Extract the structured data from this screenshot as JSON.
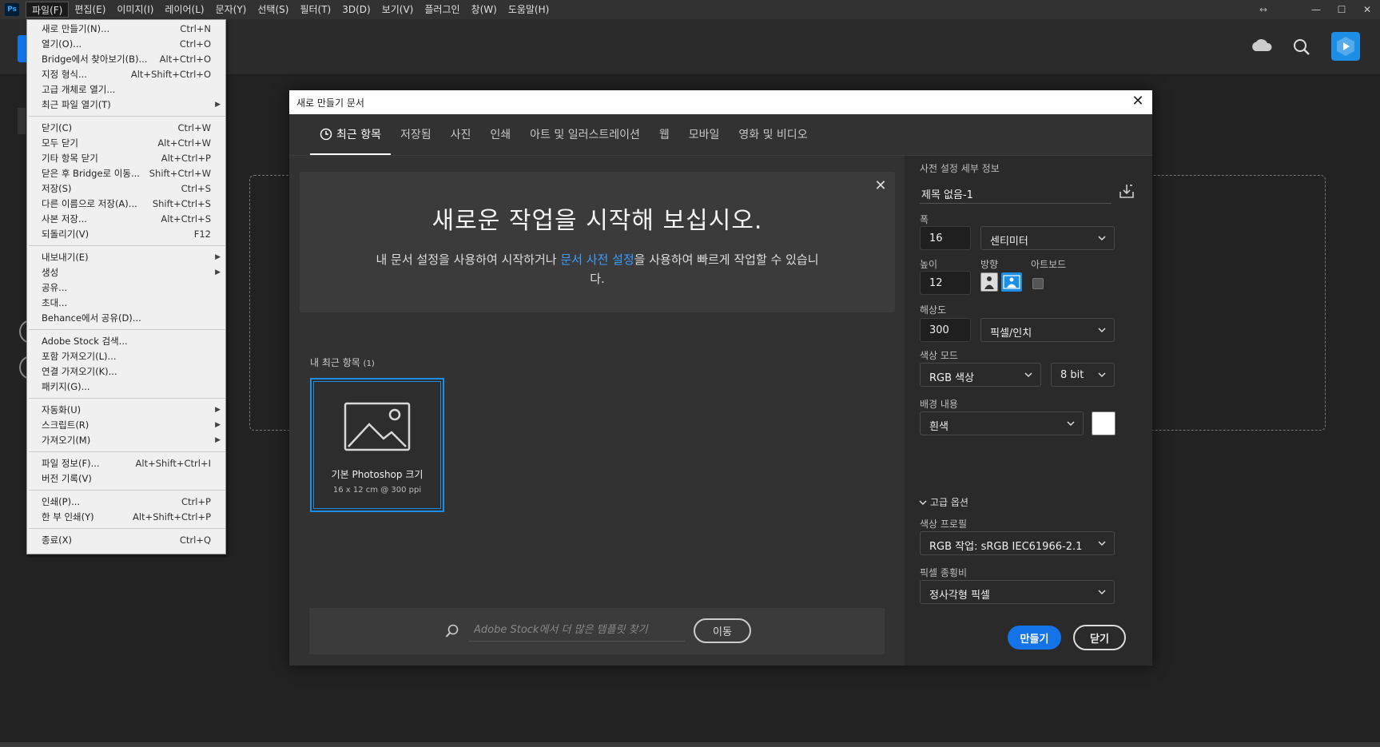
{
  "menubar": {
    "logo": "Ps",
    "items": [
      "파일(F)",
      "편집(E)",
      "이미지(I)",
      "레이어(L)",
      "문자(Y)",
      "선택(S)",
      "필터(T)",
      "3D(D)",
      "보기(V)",
      "플러그인",
      "창(W)",
      "도움말(H)"
    ],
    "active_index": 0,
    "window_buttons": [
      "—",
      "☐",
      "✕"
    ]
  },
  "file_menu": {
    "groups": [
      [
        {
          "label": "새로 만들기(N)...",
          "shortcut": "Ctrl+N"
        },
        {
          "label": "열기(O)...",
          "shortcut": "Ctrl+O"
        },
        {
          "label": "Bridge에서 찾아보기(B)...",
          "shortcut": "Alt+Ctrl+O"
        },
        {
          "label": "지정 형식...",
          "shortcut": "Alt+Shift+Ctrl+O"
        },
        {
          "label": "고급 개체로 열기...",
          "shortcut": ""
        },
        {
          "label": "최근 파일 열기(T)",
          "shortcut": "",
          "submenu": true
        }
      ],
      [
        {
          "label": "닫기(C)",
          "shortcut": "Ctrl+W"
        },
        {
          "label": "모두 닫기",
          "shortcut": "Alt+Ctrl+W"
        },
        {
          "label": "기타 항목 닫기",
          "shortcut": "Alt+Ctrl+P"
        },
        {
          "label": "닫은 후 Bridge로 이동...",
          "shortcut": "Shift+Ctrl+W"
        },
        {
          "label": "저장(S)",
          "shortcut": "Ctrl+S"
        },
        {
          "label": "다른 이름으로 저장(A)...",
          "shortcut": "Shift+Ctrl+S"
        },
        {
          "label": "사본 저장...",
          "shortcut": "Alt+Ctrl+S"
        },
        {
          "label": "되돌리기(V)",
          "shortcut": "F12"
        }
      ],
      [
        {
          "label": "내보내기(E)",
          "shortcut": "",
          "submenu": true
        },
        {
          "label": "생성",
          "shortcut": "",
          "submenu": true
        },
        {
          "label": "공유...",
          "shortcut": ""
        },
        {
          "label": "초대...",
          "shortcut": ""
        },
        {
          "label": "Behance에서 공유(D)...",
          "shortcut": ""
        }
      ],
      [
        {
          "label": "Adobe Stock 검색...",
          "shortcut": ""
        },
        {
          "label": "포함 가져오기(L)...",
          "shortcut": ""
        },
        {
          "label": "연결 가져오기(K)...",
          "shortcut": ""
        },
        {
          "label": "패키지(G)...",
          "shortcut": ""
        }
      ],
      [
        {
          "label": "자동화(U)",
          "shortcut": "",
          "submenu": true
        },
        {
          "label": "스크립트(R)",
          "shortcut": "",
          "submenu": true
        },
        {
          "label": "가져오기(M)",
          "shortcut": "",
          "submenu": true
        }
      ],
      [
        {
          "label": "파일 정보(F)...",
          "shortcut": "Alt+Shift+Ctrl+I"
        },
        {
          "label": "버전 기록(V)",
          "shortcut": ""
        }
      ],
      [
        {
          "label": "인쇄(P)...",
          "shortcut": "Ctrl+P"
        },
        {
          "label": "한 부 인쇄(Y)",
          "shortcut": "Alt+Shift+Ctrl+P"
        }
      ],
      [
        {
          "label": "종료(X)",
          "shortcut": "Ctrl+Q"
        }
      ]
    ]
  },
  "dialog": {
    "title": "새로 만들기 문서",
    "tabs": [
      "최근 항목",
      "저장됨",
      "사진",
      "인쇄",
      "아트 및 일러스트레이션",
      "웹",
      "모바일",
      "영화 및 비디오"
    ],
    "active_tab": 0,
    "hero": {
      "title": "새로운 작업을 시작해 보십시오.",
      "sub_before": "내 문서 설정을 사용하여 시작하거나 ",
      "sub_link": "문서 사전 설정",
      "sub_after": "을 사용하여 빠르게 작업할 수 있습니다."
    },
    "recent": {
      "label": "내 최근 항목",
      "count": "(1)",
      "card_name": "기본 Photoshop 크기",
      "card_meta": "16 x 12 cm @ 300 ppi"
    },
    "stock": {
      "placeholder": "Adobe Stock에서 더 많은 템플릿 찾기",
      "go": "이동"
    },
    "details": {
      "header": "사전 설정 세부 정보",
      "name": "제목 없음-1",
      "width_label": "폭",
      "width": "16",
      "width_unit": "센티미터",
      "height_label": "높이",
      "height": "12",
      "orientation_label": "방향",
      "artboard_label": "아트보드",
      "resolution_label": "해상도",
      "resolution": "300",
      "resolution_unit": "픽셀/인치",
      "color_mode_label": "색상 모드",
      "color_mode": "RGB 색상",
      "bit_depth": "8 bit",
      "background_label": "배경 내용",
      "background": "흰색",
      "advanced": "고급 옵션",
      "profile_label": "색상 프로필",
      "profile": "RGB 작업: sRGB IEC61966-2.1",
      "pixel_aspect_label": "픽셀 종횡비",
      "pixel_aspect": "정사각형 픽셀"
    },
    "buttons": {
      "create": "만들기",
      "close": "닫기"
    }
  },
  "colors": {
    "accent": "#1473e6",
    "link": "#3a9dff",
    "selection": "#1c8ee6"
  }
}
